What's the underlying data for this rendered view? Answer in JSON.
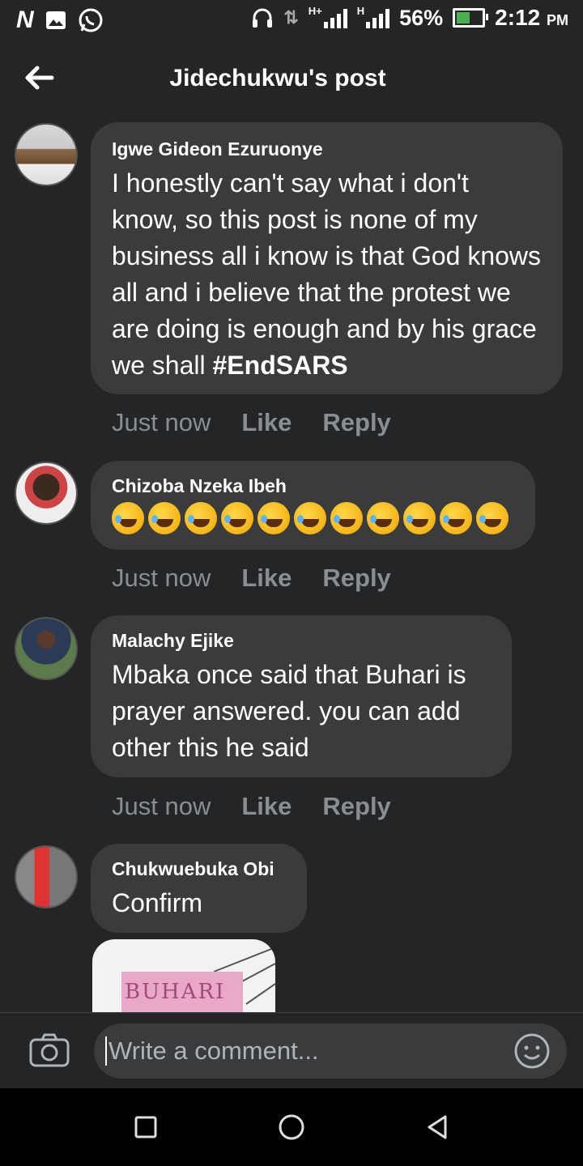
{
  "status_bar": {
    "left_icons": [
      "n-logo-icon",
      "image-icon",
      "whatsapp-icon"
    ],
    "network": "H+",
    "network2": "H",
    "battery": "56%",
    "battery_level": 0.56,
    "time": "2:12",
    "ampm": "PM"
  },
  "header": {
    "back_icon": "arrow-left-icon",
    "title": "Jidechukwu's post"
  },
  "comments": [
    {
      "author": "Igwe Gideon Ezuruonye",
      "text": "I honestly can't say what i don't know, so this post is none of my business all i know is that God knows all and i believe that the protest we are doing is enough and by his grace we shall",
      "hashtag": "#EndSARS",
      "time": "Just now",
      "like": "Like",
      "reply": "Reply"
    },
    {
      "author": "Chizoba Nzeka Ibeh",
      "emoji_count": 11,
      "emoji_name": "rolling-on-floor-laughing-emoji",
      "time": "Just now",
      "like": "Like",
      "reply": "Reply"
    },
    {
      "author": "Malachy Ejike",
      "text": "Mbaka once said that Buhari is prayer answered. you can add other this he said",
      "time": "Just now",
      "like": "Like",
      "reply": "Reply"
    },
    {
      "author": "Chukwuebuka Obi",
      "text": "Confirm",
      "image_text": "BUHARI"
    }
  ],
  "composer": {
    "placeholder": "Write a comment...",
    "camera_icon": "camera-icon",
    "emoji_icon": "smiley-icon"
  },
  "nav": [
    "recents-square-icon",
    "home-circle-icon",
    "back-triangle-icon"
  ],
  "colors": {
    "background": "#242526",
    "bubble": "#3a3b3c",
    "muted": "#8a8d91"
  }
}
